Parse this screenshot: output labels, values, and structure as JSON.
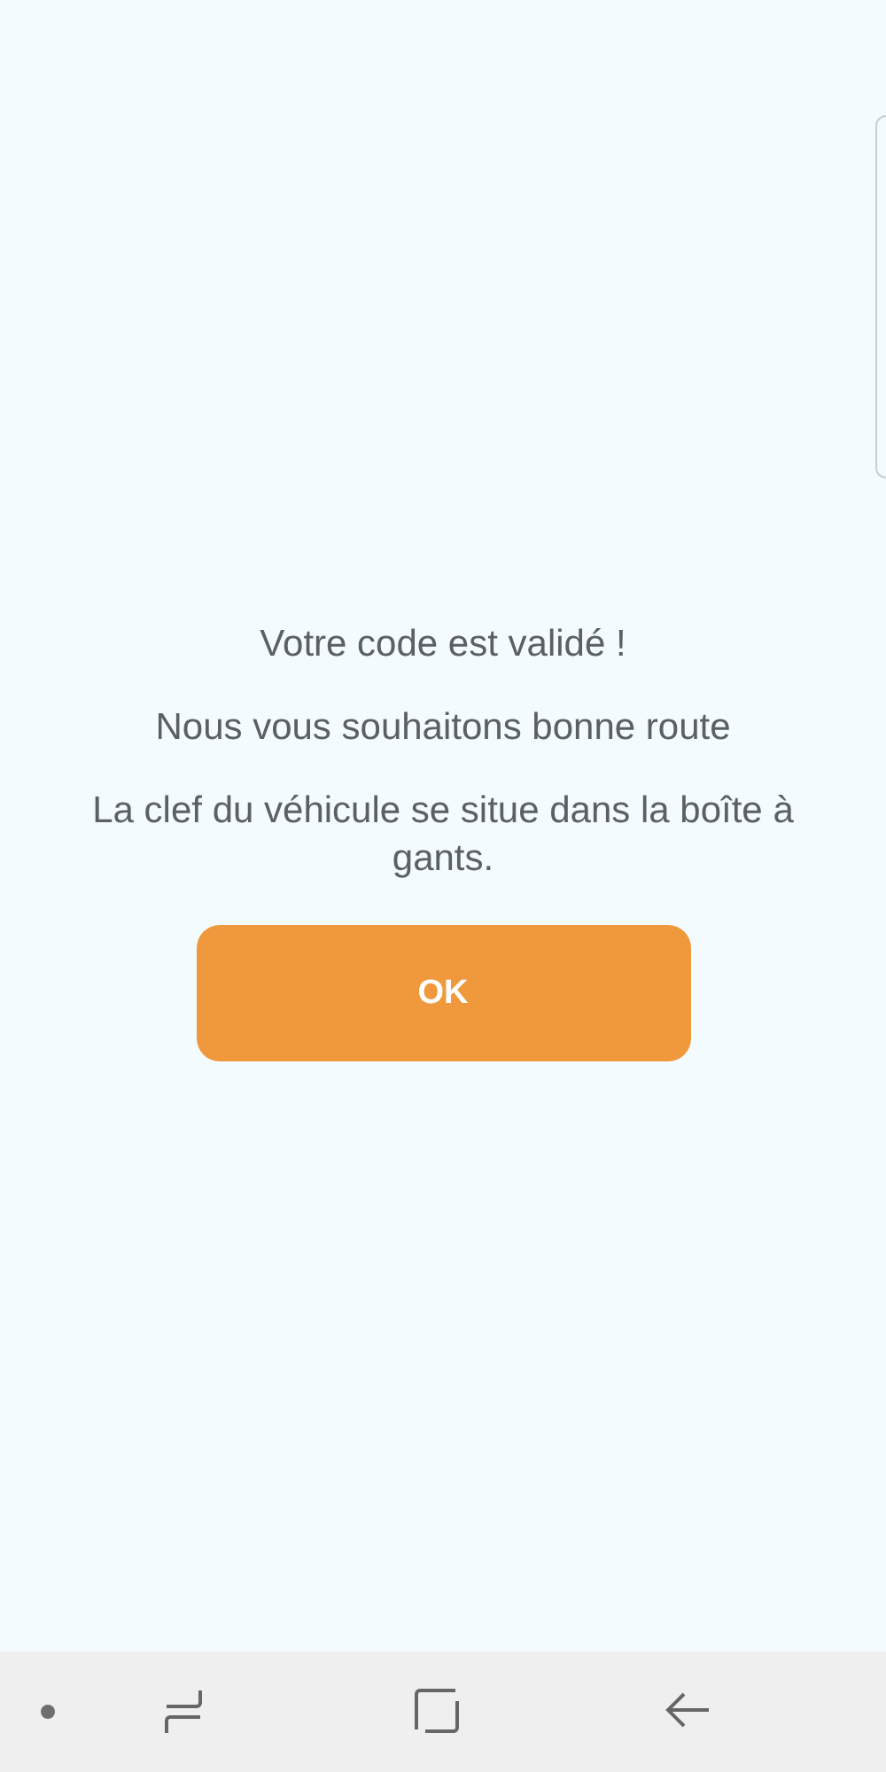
{
  "dialog": {
    "messages": [
      "Votre code est validé !",
      "Nous vous souhaitons bonne route",
      "La clef du véhicule se situe dans la boîte à gants."
    ],
    "button": "OK"
  }
}
